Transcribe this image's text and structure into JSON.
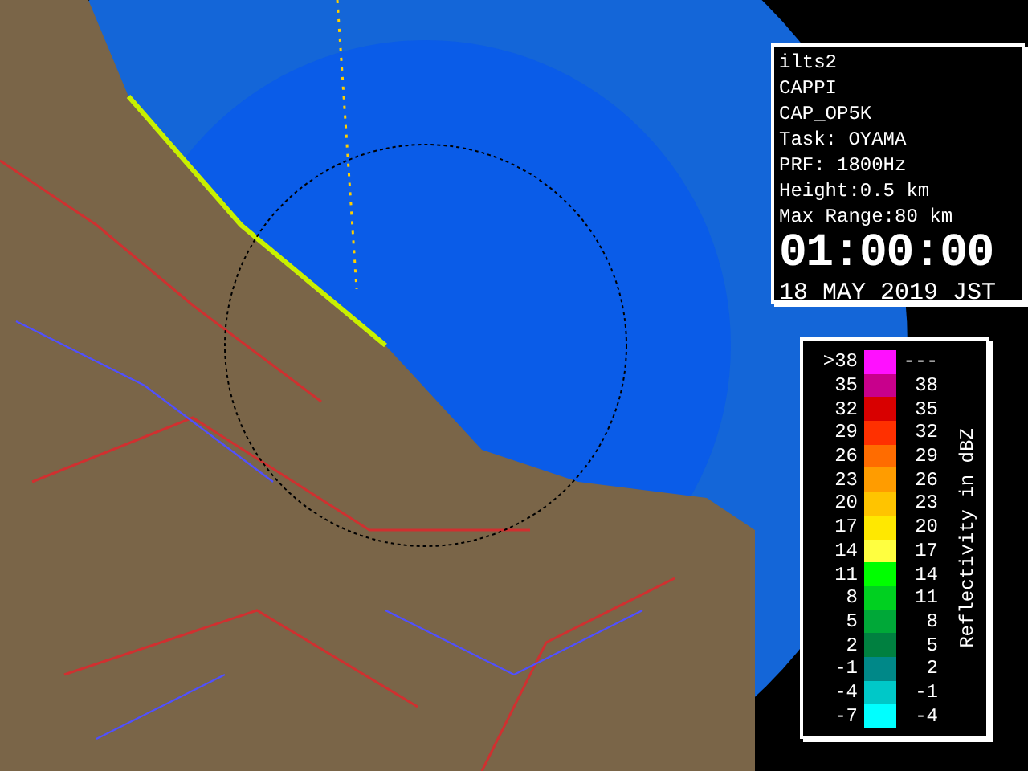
{
  "info_panel": {
    "lines": [
      "ilts2",
      "CAPPI",
      "CAP_OP5K",
      "Task: OYAMA",
      "PRF: 1800Hz",
      "Height:0.5 km",
      "Max Range:80 km"
    ],
    "time": "01:00:00",
    "date": "18 MAY 2019 JST"
  },
  "legend": {
    "title": "Reflectivity in dBZ",
    "rows": [
      {
        "low": ">38",
        "high": "---",
        "color": "#ff10ff"
      },
      {
        "low": "35",
        "high": "38",
        "color": "#c8008c"
      },
      {
        "low": "32",
        "high": "35",
        "color": "#d80000"
      },
      {
        "low": "29",
        "high": "32",
        "color": "#ff3000"
      },
      {
        "low": "26",
        "high": "29",
        "color": "#ff6c00"
      },
      {
        "low": "23",
        "high": "26",
        "color": "#ff9c00"
      },
      {
        "low": "20",
        "high": "23",
        "color": "#ffc400"
      },
      {
        "low": "17",
        "high": "20",
        "color": "#ffe800"
      },
      {
        "low": "14",
        "high": "17",
        "color": "#ffff40"
      },
      {
        "low": "11",
        "high": "14",
        "color": "#00ff00"
      },
      {
        "low": "8",
        "high": "11",
        "color": "#00d020"
      },
      {
        "low": "5",
        "high": "8",
        "color": "#00a838"
      },
      {
        "low": "2",
        "high": "5",
        "color": "#008040"
      },
      {
        "low": "-1",
        "high": "2",
        "color": "#008888"
      },
      {
        "low": "-4",
        "high": "-1",
        "color": "#00c8c8"
      },
      {
        "low": "-7",
        "high": "-4",
        "color": "#00ffff"
      }
    ]
  }
}
